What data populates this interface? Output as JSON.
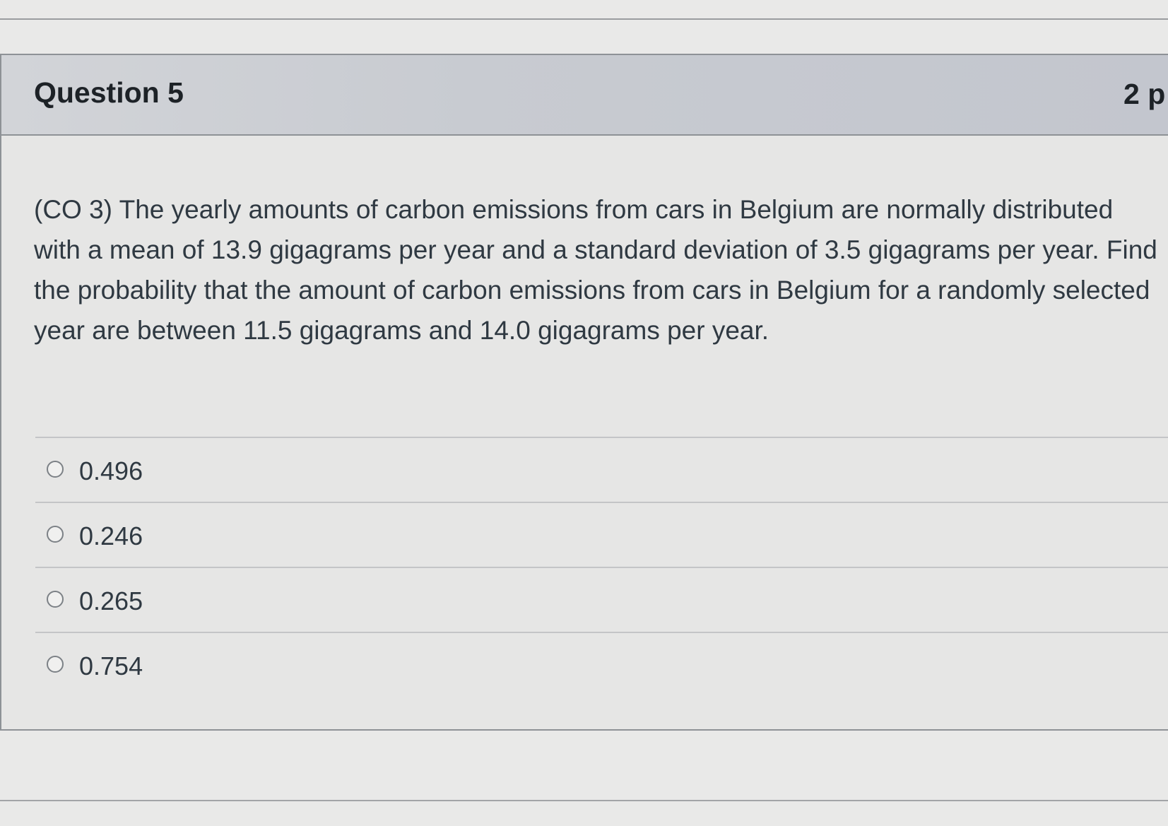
{
  "question": {
    "title": "Question 5",
    "points": "2 p",
    "text": "(CO 3) The yearly amounts of carbon emissions from cars in Belgium are normally distributed with a mean of 13.9 gigagrams per year and a standard deviation of 3.5 gigagrams per year. Find the probability that the amount of carbon emissions from cars in Belgium for a randomly selected year are between 11.5 gigagrams and 14.0 gigagrams per year.",
    "answers": [
      {
        "label": "0.496",
        "selected": false
      },
      {
        "label": "0.246",
        "selected": false
      },
      {
        "label": "0.265",
        "selected": false
      },
      {
        "label": "0.754",
        "selected": false
      }
    ]
  }
}
